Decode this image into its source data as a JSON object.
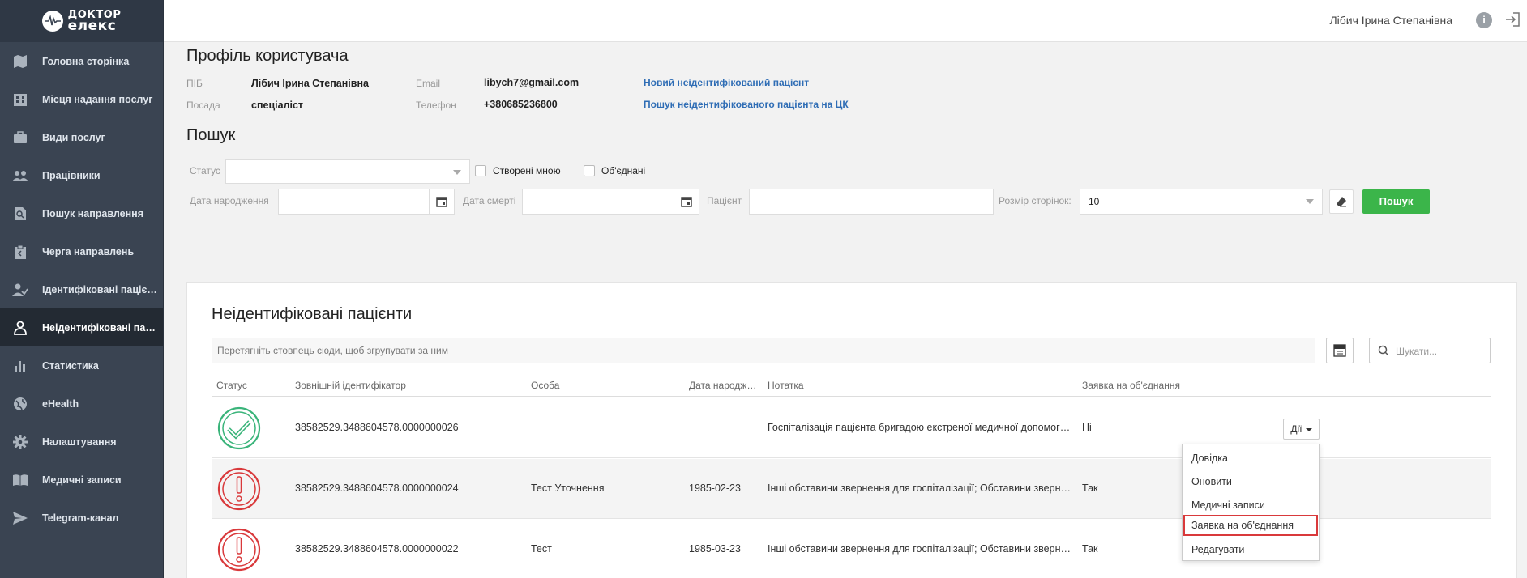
{
  "logo": {
    "line1": "ДОКТОР",
    "line2": "елекс"
  },
  "sidebar": {
    "items": [
      {
        "label": "Головна сторінка",
        "icon": "map-icon"
      },
      {
        "label": "Місця надання послуг",
        "icon": "building-icon"
      },
      {
        "label": "Види послуг",
        "icon": "briefcase-icon"
      },
      {
        "label": "Працівники",
        "icon": "people-icon"
      },
      {
        "label": "Пошук направлення",
        "icon": "document-search-icon"
      },
      {
        "label": "Черга направлень",
        "icon": "clipboard-icon"
      },
      {
        "label": "Ідентифіковані пацієнти",
        "icon": "user-check-icon"
      },
      {
        "label": "Неідентифіковані паціє...",
        "icon": "person-icon",
        "active": true
      },
      {
        "label": "Статистика",
        "icon": "bar-chart-icon"
      },
      {
        "label": "eHealth",
        "icon": "globe-icon"
      },
      {
        "label": "Налаштування",
        "icon": "gear-icon"
      },
      {
        "label": "Медичні записи",
        "icon": "book-icon"
      },
      {
        "label": "Telegram-канал",
        "icon": "send-icon"
      }
    ]
  },
  "topbar": {
    "user_name": "Лібич Ірина Степанівна"
  },
  "profile": {
    "title": "Профіль користувача",
    "pib_label": "ПІБ",
    "pib_value": "Лібич Ірина Степанівна",
    "position_label": "Посада",
    "position_value": "спеціаліст",
    "email_label": "Email",
    "email_value": "libych7@gmail.com",
    "phone_label": "Телефон",
    "phone_value": "+380685236800",
    "link_new": "Новий неідентифікований пацієнт",
    "link_search": "Пошук неідентифікованого пацієнта на ЦК"
  },
  "search": {
    "title": "Пошук",
    "status_label": "Статус",
    "status_value": "",
    "created_by_me_label": "Створені мною",
    "merged_label": "Об'єднані",
    "birth_date_label": "Дата народження",
    "death_date_label": "Дата смерті",
    "patient_label": "Пацієнт",
    "page_size_label": "Розмір сторінок:",
    "page_size_value": "10",
    "search_button": "Пошук"
  },
  "table": {
    "title": "Неідентифіковані пацієнти",
    "group_hint": "Перетягніть стовпець сюди, щоб згрупувати за ним",
    "search_placeholder": "Шукати...",
    "columns": [
      "Статус",
      "Зовнішній ідентифікатор",
      "Особа",
      "Дата народжен...",
      "Нотатка",
      "Заявка на об'єднання"
    ],
    "rows": [
      {
        "status": "ok",
        "external_id": "38582529.3488604578.0000000026",
        "person": "",
        "birth_date": "",
        "note": "Госпіталізація пацієнта бригадою екстреної медичної допомоги; № карт...",
        "merge_request": "Ні"
      },
      {
        "status": "warning",
        "external_id": "38582529.3488604578.0000000024",
        "person": "Тест Уточнення",
        "birth_date": "1985-02-23",
        "note": "Інші обставини звернення для госпіталізації; Обставини звернення для г...",
        "merge_request": "Так"
      },
      {
        "status": "warning",
        "external_id": "38582529.3488604578.0000000022",
        "person": "Тест",
        "birth_date": "1985-03-23",
        "note": "Інші обставини звернення для госпіталізації; Обставини звернення для г...",
        "merge_request": "Так"
      }
    ],
    "actions_label": "Дії",
    "dropdown": [
      "Довідка",
      "Оновити",
      "Медичні записи",
      "Заявка на об'єднання",
      "Редагувати"
    ]
  },
  "colors": {
    "sidebar": "#3a4452",
    "active": "#232a33",
    "accent_green": "#3bb54a",
    "link": "#2f6db5",
    "ok": "#3ab47a",
    "warning": "#d9393b"
  }
}
